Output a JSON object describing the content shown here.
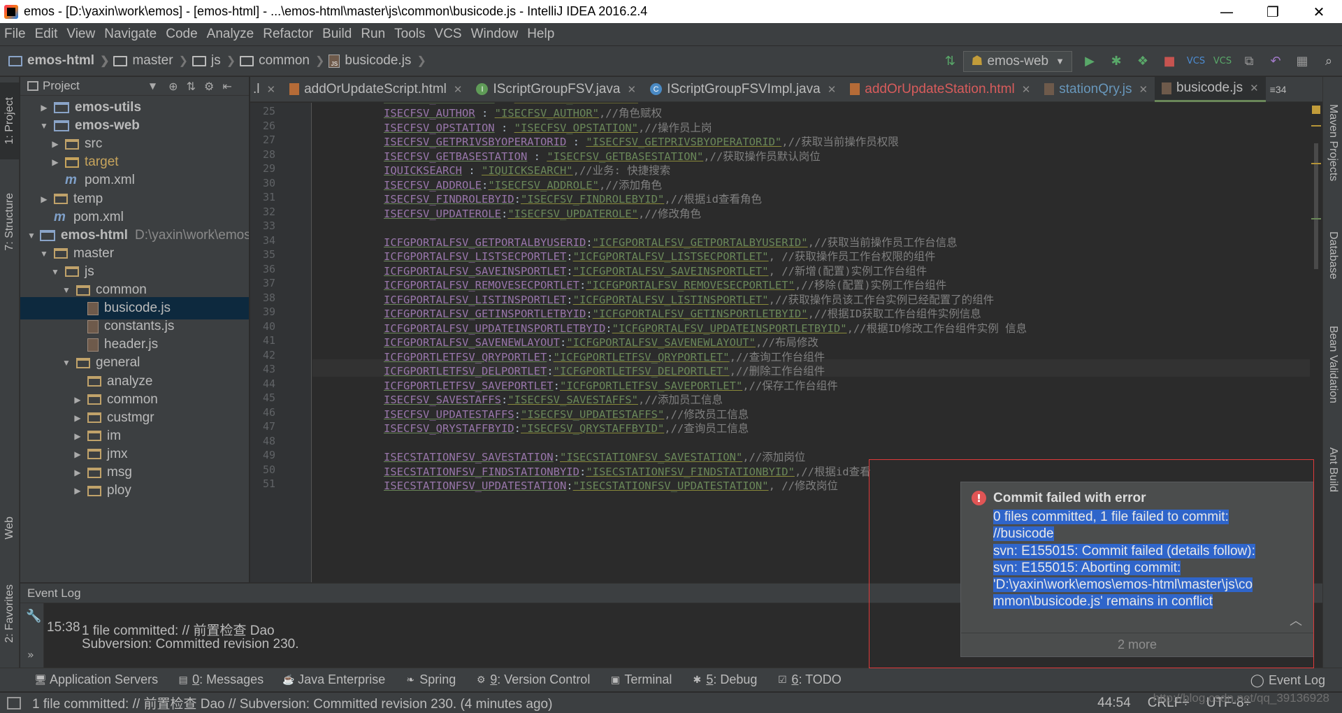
{
  "window": {
    "title": "emos - [D:\\yaxin\\work\\emos] - [emos-html] - ...\\emos-html\\master\\js\\common\\busicode.js - IntelliJ IDEA 2016.2.4",
    "minimize": "—",
    "maximize": "❐",
    "close": "✕"
  },
  "menu": [
    "File",
    "Edit",
    "View",
    "Navigate",
    "Code",
    "Analyze",
    "Refactor",
    "Build",
    "Run",
    "Tools",
    "VCS",
    "Window",
    "Help"
  ],
  "breadcrumbs": [
    "emos-html",
    "master",
    "js",
    "common",
    "busicode.js"
  ],
  "run_config": "emos-web",
  "left_stripe": [
    "1: Project",
    "7: Structure",
    "Web",
    "2: Favorites"
  ],
  "right_stripe": [
    "Maven Projects",
    "Database",
    "Bean Validation",
    "Ant Build"
  ],
  "project_panel": {
    "title": "Project",
    "tree": [
      {
        "label": "emos-utils",
        "depth": 0,
        "kind": "module",
        "arrow": "▶"
      },
      {
        "label": "emos-web",
        "depth": 0,
        "kind": "module",
        "arrow": "▼"
      },
      {
        "label": "src",
        "depth": 1,
        "kind": "folder",
        "arrow": "▶"
      },
      {
        "label": "target",
        "depth": 1,
        "kind": "target",
        "arrow": "▶"
      },
      {
        "label": "pom.xml",
        "depth": 1,
        "kind": "pom",
        "arrow": ""
      },
      {
        "label": "temp",
        "depth": 0,
        "kind": "folder",
        "arrow": "▶"
      },
      {
        "label": "pom.xml",
        "depth": 0,
        "kind": "pom",
        "arrow": ""
      },
      {
        "label": "emos-html",
        "depth": -1,
        "kind": "module",
        "arrow": "▼",
        "path": "D:\\yaxin\\work\\emos"
      },
      {
        "label": "master",
        "depth": 0,
        "kind": "folder",
        "arrow": "▼"
      },
      {
        "label": "js",
        "depth": 1,
        "kind": "folder",
        "arrow": "▼"
      },
      {
        "label": "common",
        "depth": 2,
        "kind": "folder",
        "arrow": "▼"
      },
      {
        "label": "busicode.js",
        "depth": 3,
        "kind": "js",
        "arrow": "",
        "selected": true
      },
      {
        "label": "constants.js",
        "depth": 3,
        "kind": "js",
        "arrow": ""
      },
      {
        "label": "header.js",
        "depth": 3,
        "kind": "js",
        "arrow": ""
      },
      {
        "label": "general",
        "depth": 2,
        "kind": "folder",
        "arrow": "▼"
      },
      {
        "label": "analyze",
        "depth": 3,
        "kind": "folder",
        "arrow": ""
      },
      {
        "label": "common",
        "depth": 3,
        "kind": "folder",
        "arrow": "▶"
      },
      {
        "label": "custmgr",
        "depth": 3,
        "kind": "folder",
        "arrow": "▶"
      },
      {
        "label": "im",
        "depth": 3,
        "kind": "folder",
        "arrow": "▶"
      },
      {
        "label": "jmx",
        "depth": 3,
        "kind": "folder",
        "arrow": "▶"
      },
      {
        "label": "msg",
        "depth": 3,
        "kind": "folder",
        "arrow": "▶"
      },
      {
        "label": "ploy",
        "depth": 3,
        "kind": "folder",
        "arrow": "▶"
      }
    ]
  },
  "tabs": [
    {
      "label": "addOrUpdateScript.html",
      "icon": "h",
      "color": ""
    },
    {
      "label": "IScriptGroupFSV.java",
      "icon": "i",
      "color": ""
    },
    {
      "label": "IScriptGroupFSVImpl.java",
      "icon": "c",
      "color": ""
    },
    {
      "label": "addOrUpdateStation.html",
      "icon": "h",
      "color": "red"
    },
    {
      "label": "stationQry.js",
      "icon": "j",
      "color": "blue"
    },
    {
      "label": "busicode.js",
      "icon": "j",
      "color": "",
      "active": true
    }
  ],
  "tab_overflow": "≡34",
  "code": {
    "lines": [
      {
        "no": "25",
        "key": "ISECFSV_AUTHOR",
        "sep": " : ",
        "val": "\"ISECFSV_AUTHOR\"",
        "comment": ",//角色赋权"
      },
      {
        "no": "26",
        "key": "ISECFSV_OPSTATION",
        "sep": " : ",
        "val": "\"ISECFSV_OPSTATION\"",
        "comment": ",//操作员上岗"
      },
      {
        "no": "27",
        "key": "ISECFSV_GETPRIVSBYOPERATORID",
        "sep": " : ",
        "val": "\"ISECFSV_GETPRIVSBYOPERATORID\"",
        "comment": ",//获取当前操作员权限"
      },
      {
        "no": "28",
        "key": "ISECFSV_GETBASESTATION",
        "sep": " : ",
        "val": "\"ISECFSV_GETBASESTATION\"",
        "comment": ",//获取操作员默认岗位"
      },
      {
        "no": "29",
        "key": "IQUICKSEARCH",
        "sep": " : ",
        "val": "\"IQUICKSEARCH\"",
        "comment": ",//业务: 快捷搜索"
      },
      {
        "no": "30",
        "key": "ISECFSV_ADDROLE",
        "sep": ":",
        "val": "\"ISECFSV_ADDROLE\"",
        "comment": ",//添加角色"
      },
      {
        "no": "31",
        "key": "ISECFSV_FINDROLEBYID",
        "sep": ":",
        "val": "\"ISECFSV_FINDROLEBYID\"",
        "comment": ",//根据id查看角色"
      },
      {
        "no": "32",
        "key": "ISECFSV_UPDATEROLE",
        "sep": ":",
        "val": "\"ISECFSV_UPDATEROLE\"",
        "comment": ",//修改角色"
      },
      {
        "no": "33",
        "key": "",
        "sep": "",
        "val": "",
        "comment": ""
      },
      {
        "no": "34",
        "key": "ICFGPORTALFSV_GETPORTALBYUSERID",
        "sep": ":",
        "val": "\"ICFGPORTALFSV_GETPORTALBYUSERID\"",
        "comment": ",//获取当前操作员工作台信息"
      },
      {
        "no": "35",
        "key": "ICFGPORTALFSV_LISTSECPORTLET",
        "sep": ":",
        "val": "\"ICFGPORTALFSV_LISTSECPORTLET\"",
        "comment": ", //获取操作员工作台权限的组件"
      },
      {
        "no": "36",
        "key": "ICFGPORTALFSV_SAVEINSPORTLET",
        "sep": ":",
        "val": "\"ICFGPORTALFSV_SAVEINSPORTLET\"",
        "comment": ", //新增(配置)实例工作台组件"
      },
      {
        "no": "37",
        "key": "ICFGPORTALFSV_REMOVESECPORTLET",
        "sep": ":",
        "val": "\"ICFGPORTALFSV_REMOVESECPORTLET\"",
        "comment": ",//移除(配置)实例工作台组件"
      },
      {
        "no": "38",
        "key": "ICFGPORTALFSV_LISTINSPORTLET",
        "sep": ":",
        "val": "\"ICFGPORTALFSV_LISTINSPORTLET\"",
        "comment": ",//获取操作员该工作台实例已经配置了的组件"
      },
      {
        "no": "39",
        "key": "ICFGPORTALFSV_GETINSPORTLETBYID",
        "sep": ":",
        "val": "\"ICFGPORTALFSV_GETINSPORTLETBYID\"",
        "comment": ",//根据ID获取工作台组件实例信息"
      },
      {
        "no": "40",
        "key": "ICFGPORTALFSV_UPDATEINSPORTLETBYID",
        "sep": ":",
        "val": "\"ICFGPORTALFSV_UPDATEINSPORTLETBYID\"",
        "comment": ",//根据ID修改工作台组件实例 信息"
      },
      {
        "no": "41",
        "key": "ICFGPORTALFSV_SAVENEWLAYOUT",
        "sep": ":",
        "val": "\"ICFGPORTALFSV_SAVENEWLAYOUT\"",
        "comment": ",//布局修改"
      },
      {
        "no": "42",
        "key": "ICFGPORTLETFSV_QRYPORTLET",
        "sep": ":",
        "val": "\"ICFGPORTLETFSV_QRYPORTLET\"",
        "comment": ",//查询工作台组件"
      },
      {
        "no": "43",
        "key": "ICFGPORTLETFSV_DELPORTLET",
        "sep": ":",
        "val": "\"ICFGPORTLETFSV_DELPORTLET\"",
        "comment": ",//删除工作台组件"
      },
      {
        "no": "44",
        "key": "ICFGPORTLETFSV_SAVEPORTLET",
        "sep": ":",
        "val": "\"ICFGPORTLETFSV_SAVEPORTLET\"",
        "comment": ",//保存工作台组件"
      },
      {
        "no": "45",
        "key": "ISECFSV_SAVESTAFFS",
        "sep": ":",
        "val": "\"ISECFSV_SAVESTAFFS\"",
        "comment": ",//添加员工信息"
      },
      {
        "no": "46",
        "key": "ISECFSV_UPDATESTAFFS",
        "sep": ":",
        "val": "\"ISECFSV_UPDATESTAFFS\"",
        "comment": ",//修改员工信息"
      },
      {
        "no": "47",
        "key": "ISECFSV_QRYSTAFFBYID",
        "sep": ":",
        "val": "\"ISECFSV_QRYSTAFFBYID\"",
        "comment": ",//查询员工信息"
      },
      {
        "no": "48",
        "key": "",
        "sep": "",
        "val": "",
        "comment": ""
      },
      {
        "no": "49",
        "key": "ISECSTATIONFSV_SAVESTATION",
        "sep": ":",
        "val": "\"ISECSTATIONFSV_SAVESTATION\"",
        "comment": ",//添加岗位"
      },
      {
        "no": "50",
        "key": "ISECSTATIONFSV_FINDSTATIONBYID",
        "sep": ":",
        "val": "\"ISECSTATIONFSV_FINDSTATIONBYID\"",
        "comment": ",//根据id查看"
      },
      {
        "no": "51",
        "key": "ISECSTATIONFSV_UPDATESTATION",
        "sep": ":",
        "val": "\"ISECSTATIONFSV_UPDATESTATION\"",
        "comment": ", //修改岗位"
      }
    ]
  },
  "event_log": {
    "title": "Event Log",
    "time": "15:38",
    "message": "1 file committed: // 前置检查 Dao",
    "detail": "Subversion: Committed revision 230."
  },
  "tool_windows": [
    {
      "label": "Application Servers",
      "mnemonic": "",
      "icon": "🖥"
    },
    {
      "label": ": Messages",
      "mnemonic": "0",
      "icon": "▤"
    },
    {
      "label": "Java Enterprise",
      "mnemonic": "",
      "icon": "☕"
    },
    {
      "label": "Spring",
      "mnemonic": "",
      "icon": "❧"
    },
    {
      "label": ": Version Control",
      "mnemonic": "9",
      "icon": "⚙"
    },
    {
      "label": "Terminal",
      "mnemonic": "",
      "icon": "▣"
    },
    {
      "label": ": Debug",
      "mnemonic": "5",
      "icon": "✱"
    },
    {
      "label": ": TODO",
      "mnemonic": "6",
      "icon": "☑"
    }
  ],
  "event_log_button": "Event Log",
  "status": {
    "message": "1 file committed: // 前置检查 Dao // Subversion: Committed revision 230. (4 minutes ago)",
    "position": "44:54",
    "line_sep": "CRLF÷",
    "encoding": "UTF-8÷"
  },
  "watermark": "http://blog.csdn.net/qq_39136928",
  "notification": {
    "title": "Commit failed with error",
    "lines": [
      "0 files committed, 1 file failed to commit:",
      "//busicode",
      "svn: E155015: Commit failed (details follow):",
      "svn: E155015: Aborting commit:",
      "'D:\\yaxin\\work\\emos\\emos-html\\master\\js\\co",
      "mmon\\busicode.js' remains in conflict"
    ],
    "more": "2 more"
  }
}
